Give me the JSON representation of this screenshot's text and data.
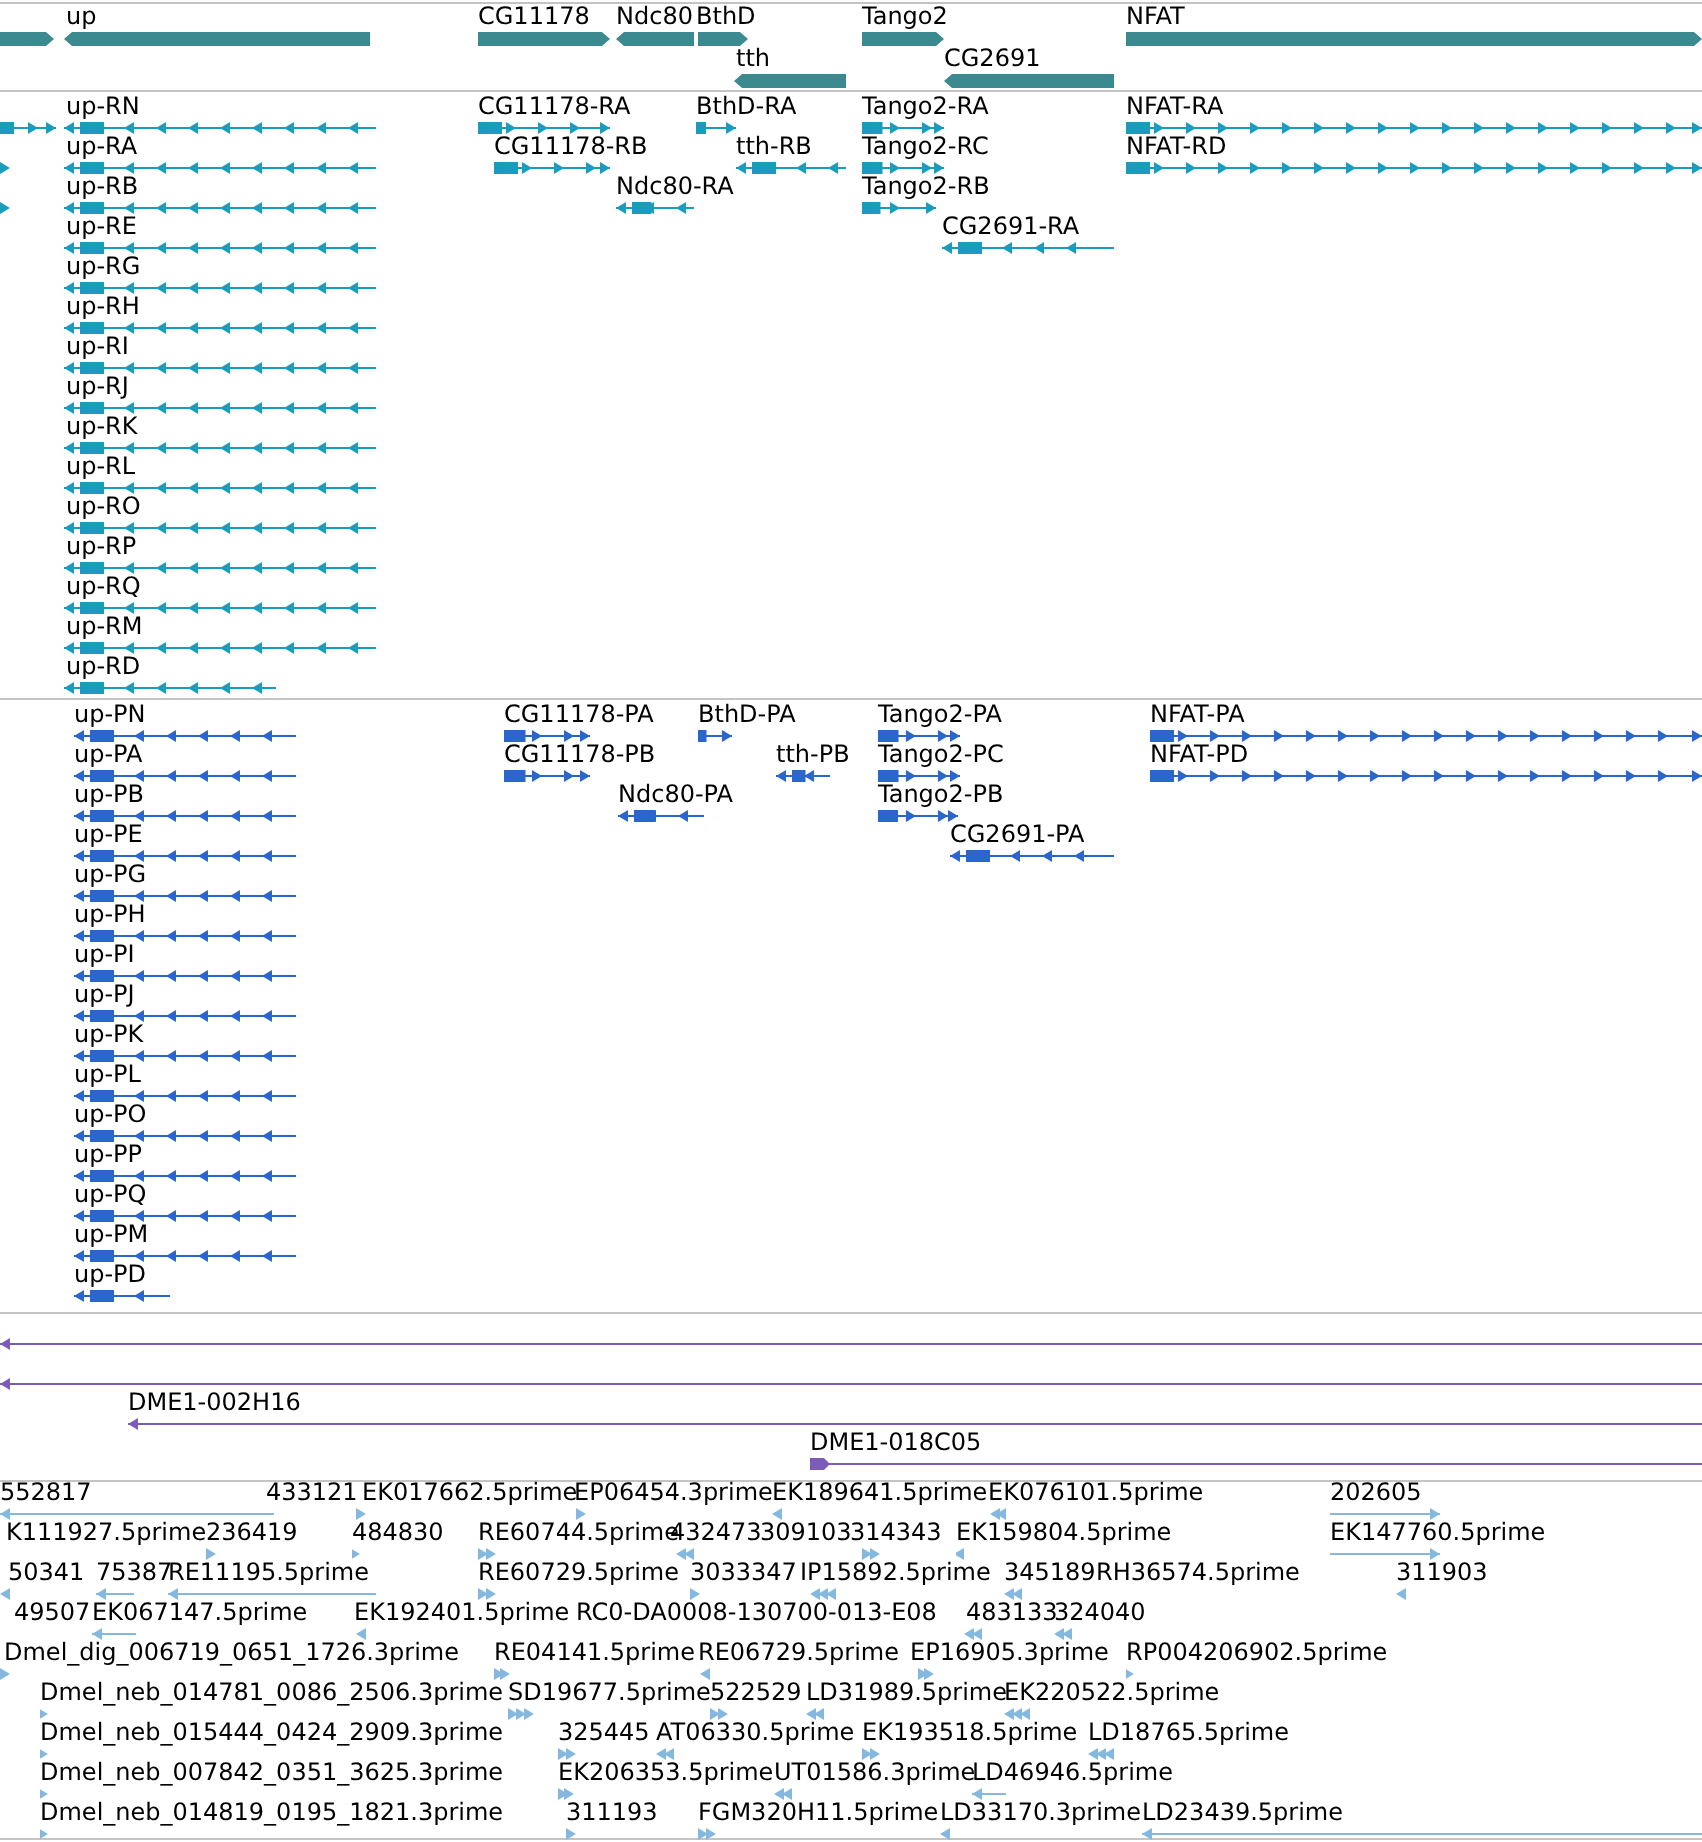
{
  "tracks": [
    {
      "kind": "gene",
      "features": [
        {
          "reverse": false
        },
        {
          "label": "up",
          "reverse": true
        },
        {
          "label": "CG11178",
          "reverse": false
        },
        {
          "label": "Ndc80",
          "reverse": true
        },
        {
          "label": "BthD",
          "reverse": false
        },
        {
          "label": "tth",
          "reverse": true
        },
        {
          "label": "Tango2",
          "reverse": false
        },
        {
          "label": "CG2691",
          "reverse": true
        },
        {
          "label": "NFAT",
          "reverse": false
        }
      ]
    },
    {
      "kind": "transcript",
      "features": [
        {
          "reverse": false
        },
        {
          "label": "up-RN",
          "reverse": true
        },
        {
          "label": "CG11178-RA",
          "reverse": false
        },
        {
          "label": "BthD-RA",
          "reverse": false
        },
        {
          "label": "Tango2-RA",
          "reverse": false
        },
        {
          "label": "NFAT-RA",
          "reverse": false
        },
        {
          "reverse": false
        },
        {
          "label": "up-RA",
          "reverse": true
        },
        {
          "label": "CG11178-RB",
          "reverse": false
        },
        {
          "label": "tth-RB",
          "reverse": true
        },
        {
          "label": "Tango2-RC",
          "reverse": false
        },
        {
          "label": "NFAT-RD",
          "reverse": false
        },
        {
          "reverse": false
        },
        {
          "label": "up-RB",
          "reverse": true
        },
        {
          "label": "Ndc80-RA",
          "reverse": true
        },
        {
          "label": "Tango2-RB",
          "reverse": false
        },
        {
          "label": "up-RE",
          "reverse": true
        },
        {
          "label": "CG2691-RA",
          "reverse": true
        },
        {
          "label": "up-RG",
          "reverse": true
        },
        {
          "label": "up-RH",
          "reverse": true
        },
        {
          "label": "up-RI",
          "reverse": true
        },
        {
          "label": "up-RJ",
          "reverse": true
        },
        {
          "label": "up-RK",
          "reverse": true
        },
        {
          "label": "up-RL",
          "reverse": true
        },
        {
          "label": "up-RO",
          "reverse": true
        },
        {
          "label": "up-RP",
          "reverse": true
        },
        {
          "label": "up-RQ",
          "reverse": true
        },
        {
          "label": "up-RM",
          "reverse": true
        },
        {
          "label": "up-RD",
          "reverse": true
        }
      ]
    },
    {
      "kind": "protein",
      "features": [
        {
          "label": "up-PN",
          "reverse": true
        },
        {
          "label": "CG11178-PA",
          "reverse": false
        },
        {
          "label": "BthD-PA",
          "reverse": false
        },
        {
          "label": "Tango2-PA",
          "reverse": false
        },
        {
          "label": "NFAT-PA",
          "reverse": false
        },
        {
          "label": "up-PA",
          "reverse": true
        },
        {
          "label": "CG11178-PB",
          "reverse": false
        },
        {
          "label": "tth-PB",
          "reverse": true
        },
        {
          "label": "Tango2-PC",
          "reverse": false
        },
        {
          "label": "NFAT-PD",
          "reverse": false
        },
        {
          "label": "up-PB",
          "reverse": true
        },
        {
          "label": "Ndc80-PA",
          "reverse": true
        },
        {
          "label": "Tango2-PB",
          "reverse": false
        },
        {
          "label": "up-PE",
          "reverse": true
        },
        {
          "label": "CG2691-PA",
          "reverse": true
        },
        {
          "label": "up-PG",
          "reverse": true
        },
        {
          "label": "up-PH",
          "reverse": true
        },
        {
          "label": "up-PI",
          "reverse": true
        },
        {
          "label": "up-PJ",
          "reverse": true
        },
        {
          "label": "up-PK",
          "reverse": true
        },
        {
          "label": "up-PL",
          "reverse": true
        },
        {
          "label": "up-PO",
          "reverse": true
        },
        {
          "label": "up-PP",
          "reverse": true
        },
        {
          "label": "up-PQ",
          "reverse": true
        },
        {
          "label": "up-PM",
          "reverse": true
        },
        {
          "label": "up-PD",
          "reverse": true
        }
      ]
    },
    {
      "kind": "clone",
      "features": [
        {
          "reverse": true
        },
        {
          "reverse": true
        },
        {
          "label": "DME1-002H16",
          "reverse": true
        },
        {
          "label": "DME1-018C05",
          "reverse": false
        }
      ]
    },
    {
      "kind": "est",
      "features": [
        {
          "label": "552817",
          "reverse": true
        },
        {
          "label": "433121"
        },
        {
          "label": "EK017662.5prime",
          "reverse": false
        },
        {
          "label": "EP06454.3prime",
          "reverse": false
        },
        {
          "label": "EK189641.5prime",
          "reverse": true
        },
        {
          "label": "EK076101.5prime",
          "reverse": true
        },
        {
          "label": "202605",
          "reverse": false
        },
        {
          "label": "K111927.5prime"
        },
        {
          "label": "236419",
          "reverse": false
        },
        {
          "label": "484830",
          "reverse": false
        },
        {
          "label": "RE60744.5prime",
          "reverse": false
        },
        {
          "label": "432473",
          "reverse": true
        },
        {
          "label": "309103"
        },
        {
          "label": "314343",
          "reverse": false
        },
        {
          "label": "EK159804.5prime",
          "reverse": true
        },
        {
          "label": "EK147760.5prime",
          "reverse": false
        },
        {
          "label": "50341",
          "reverse": true
        },
        {
          "label": "75387",
          "reverse": true
        },
        {
          "label": "RE11195.5prime",
          "reverse": true
        },
        {
          "label": "RE60729.5prime",
          "reverse": false
        },
        {
          "label": "3033347",
          "reverse": false
        },
        {
          "label": "IP15892.5prime",
          "reverse": true
        },
        {
          "label": "345189",
          "reverse": true
        },
        {
          "label": "RH36574.5prime"
        },
        {
          "label": "311903",
          "reverse": true
        },
        {
          "label": "49507"
        },
        {
          "label": "EK067147.5prime",
          "reverse": true
        },
        {
          "label": "EK192401.5prime",
          "reverse": true
        },
        {
          "label": "RC0-DA0008-130700-013-E08"
        },
        {
          "label": "483133",
          "reverse": true
        },
        {
          "label": "324040",
          "reverse": true
        },
        {
          "label": "Dmel_dig_006719_0651_1726.3prime",
          "reverse": false
        },
        {
          "label": "RE04141.5prime",
          "reverse": false
        },
        {
          "label": "RE06729.5prime",
          "reverse": true
        },
        {
          "label": "EP16905.3prime",
          "reverse": false
        },
        {
          "label": "RP004206902.5prime",
          "reverse": false
        },
        {
          "label": "Dmel_neb_014781_0086_2506.3prime",
          "reverse": false
        },
        {
          "label": "SD19677.5prime",
          "reverse": false
        },
        {
          "label": "522529",
          "reverse": false
        },
        {
          "label": "LD31989.5prime",
          "reverse": true
        },
        {
          "label": "EK220522.5prime",
          "reverse": true
        },
        {
          "label": "Dmel_neb_015444_0424_2909.3prime",
          "reverse": false
        },
        {
          "label": "325445",
          "reverse": false
        },
        {
          "label": "AT06330.5prime",
          "reverse": true
        },
        {
          "label": "EK193518.5prime",
          "reverse": false
        },
        {
          "label": "LD18765.5prime",
          "reverse": true
        },
        {
          "label": "Dmel_neb_007842_0351_3625.3prime",
          "reverse": false
        },
        {
          "label": "EK206353.5prime",
          "reverse": false
        },
        {
          "label": "UT01586.3prime",
          "reverse": true
        },
        {
          "label": "LD46946.5prime",
          "reverse": true
        },
        {
          "label": "Dmel_neb_014819_0195_1821.3prime",
          "reverse": false
        },
        {
          "label": "311193",
          "reverse": false
        },
        {
          "label": "FGM320H11.5prime",
          "reverse": false
        },
        {
          "label": "LD33170.3prime",
          "reverse": true
        },
        {
          "label": "LD23439.5prime",
          "reverse": true
        }
      ]
    }
  ]
}
